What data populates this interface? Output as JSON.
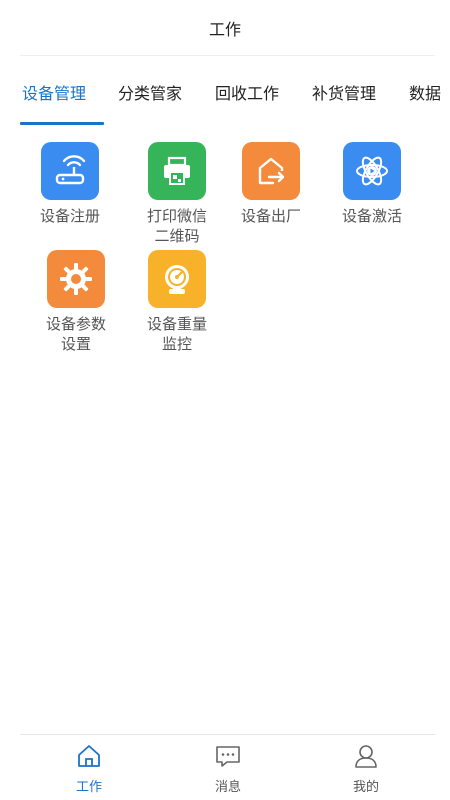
{
  "header": {
    "title": "工作"
  },
  "tabs": [
    {
      "label": "设备管理",
      "active": true
    },
    {
      "label": "分类管家"
    },
    {
      "label": "回收工作"
    },
    {
      "label": "补货管理"
    },
    {
      "label": "数据"
    }
  ],
  "tiles": [
    {
      "label": "设备注册",
      "icon": "router-icon",
      "color": "#3b8cf0"
    },
    {
      "label": "打印微信二维码",
      "icon": "printer-icon",
      "color": "#35b45a"
    },
    {
      "label": "设备出厂",
      "icon": "house-exit-icon",
      "color": "#f48a3b"
    },
    {
      "label": "设备激活",
      "icon": "atom-icon",
      "color": "#3b8cf0"
    },
    {
      "label": "设备参数设置",
      "icon": "gear-icon",
      "color": "#f48a3b"
    },
    {
      "label": "设备重量监控",
      "icon": "scale-gauge-icon",
      "color": "#f7b22a"
    }
  ],
  "bottom_nav": [
    {
      "label": "工作",
      "icon": "home-icon",
      "active": true
    },
    {
      "label": "消息",
      "icon": "message-icon"
    },
    {
      "label": "我的",
      "icon": "user-icon"
    }
  ],
  "colors": {
    "accent": "#1a73c9",
    "text": "#222222",
    "muted": "#555555"
  }
}
